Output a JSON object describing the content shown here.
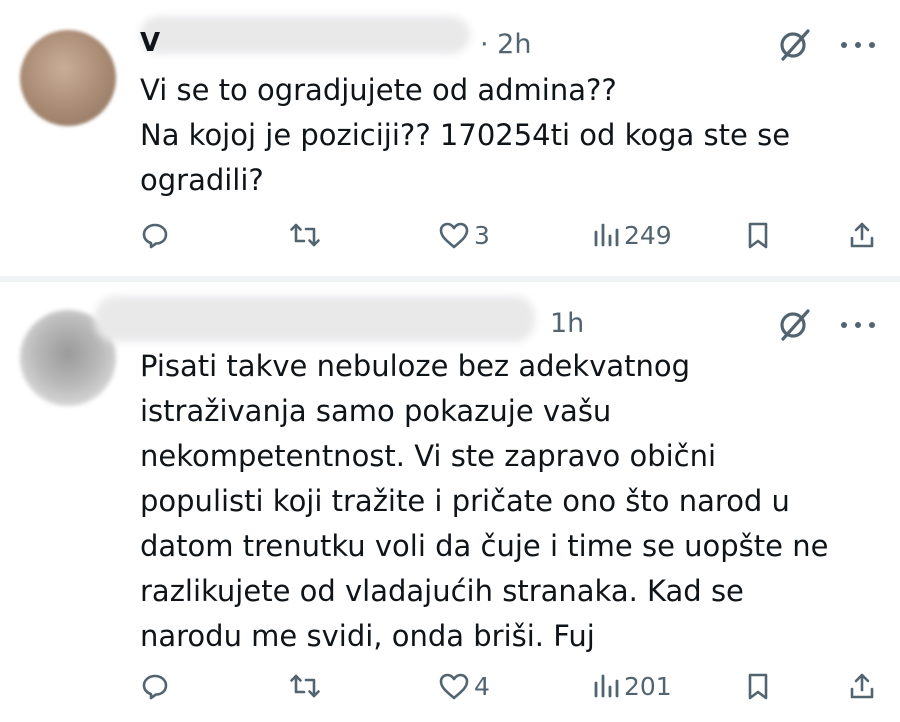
{
  "tweets": [
    {
      "author_fragment": "V",
      "time": "· 2h",
      "lines": [
        "Vi se to ogradjujete od admina??",
        "Na kojoj je poziciji?? 170254ti od koga ste se",
        "ogradili?"
      ],
      "likes": "3",
      "views": "249"
    },
    {
      "time": "1h",
      "lines": [
        "Pisati takve nebuloze bez adekvatnog",
        "istraživanja samo pokazuje vašu",
        "nekompetentnost. Vi ste zapravo obični",
        "populisti koji tražite i pričate ono što narod u",
        "datom trenutku voli da čuje i time se uopšte ne",
        "razlikujete od vladajućih stranaka. Kad se",
        "narodu me svidi, onda briši. Fuj"
      ],
      "likes": "4",
      "views": "201"
    }
  ],
  "icons": {
    "grok": "grok-icon",
    "more": "more-icon",
    "reply": "reply-icon",
    "retweet": "retweet-icon",
    "like": "heart-icon",
    "views": "views-icon",
    "bookmark": "bookmark-icon",
    "share": "share-icon"
  },
  "colors": {
    "text": "#0f1419",
    "secondary": "#536471",
    "divider": "#eff3f4"
  }
}
